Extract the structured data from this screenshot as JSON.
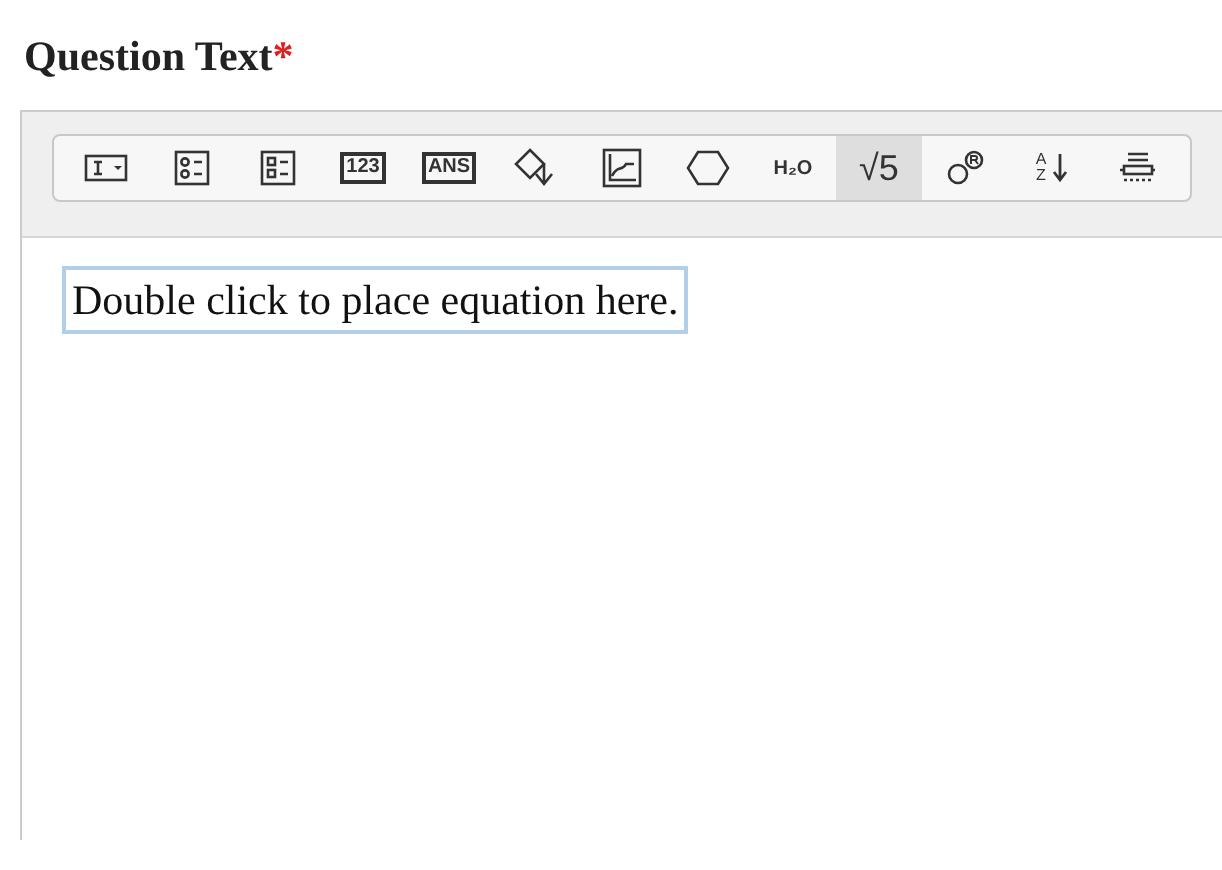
{
  "heading": {
    "label": "Question Text",
    "required_mark": "*"
  },
  "toolbar": [
    {
      "kind": "field",
      "selected": false
    },
    {
      "kind": "radios",
      "selected": false
    },
    {
      "kind": "checks",
      "selected": false
    },
    {
      "kind": "boxed",
      "label": "123",
      "selected": false
    },
    {
      "kind": "boxed",
      "label": "ANS",
      "selected": false
    },
    {
      "kind": "flow",
      "selected": false
    },
    {
      "kind": "graph",
      "selected": false
    },
    {
      "kind": "hexagon",
      "selected": false
    },
    {
      "kind": "formula",
      "label": "H₂O",
      "selected": false
    },
    {
      "kind": "plain",
      "label": "√5",
      "selected": true
    },
    {
      "kind": "atom",
      "selected": false
    },
    {
      "kind": "sort",
      "label": "AZ",
      "selected": false
    },
    {
      "kind": "table",
      "selected": false
    }
  ],
  "editor": {
    "placeholder_box": "Double click to place equation here."
  }
}
